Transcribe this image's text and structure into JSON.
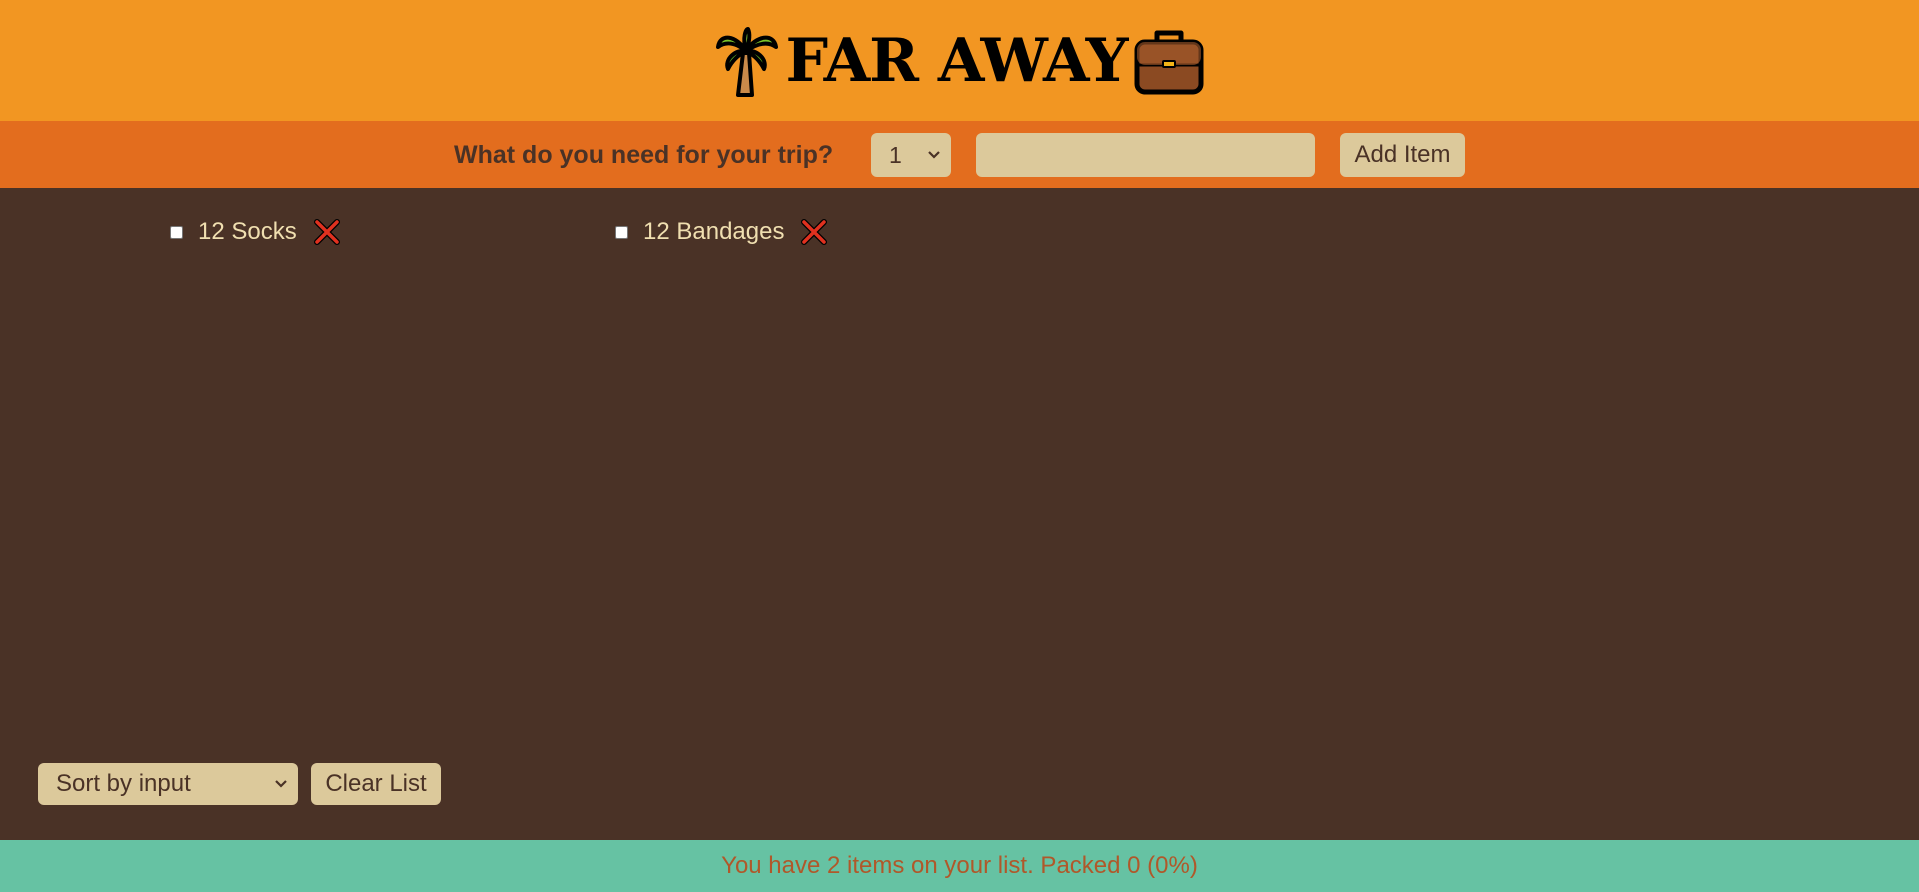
{
  "header": {
    "title": "FAR AWAY",
    "left_icon": "palm-tree-icon",
    "right_icon": "suitcase-icon"
  },
  "form": {
    "question": "What do you need for your trip?",
    "quantity_value": "1",
    "description_value": "",
    "add_button_label": "Add Item"
  },
  "items": [
    {
      "label": "12 Socks",
      "packed": false,
      "delete_icon": "close-x-icon"
    },
    {
      "label": "12 Bandages",
      "packed": false,
      "delete_icon": "close-x-icon"
    }
  ],
  "actions": {
    "sort_value": "Sort by input",
    "clear_button_label": "Clear List"
  },
  "stats": {
    "text": "You have 2 items on your list. Packed 0 (0%)"
  },
  "colors": {
    "header_bg": "#f29622",
    "form_bg": "#e36d1e",
    "main_bg": "#4a3226",
    "footer_bg": "#66c2a3",
    "control_bg": "#dcc99b",
    "item_text": "#f0dfb0",
    "stats_text": "#b0582a"
  }
}
